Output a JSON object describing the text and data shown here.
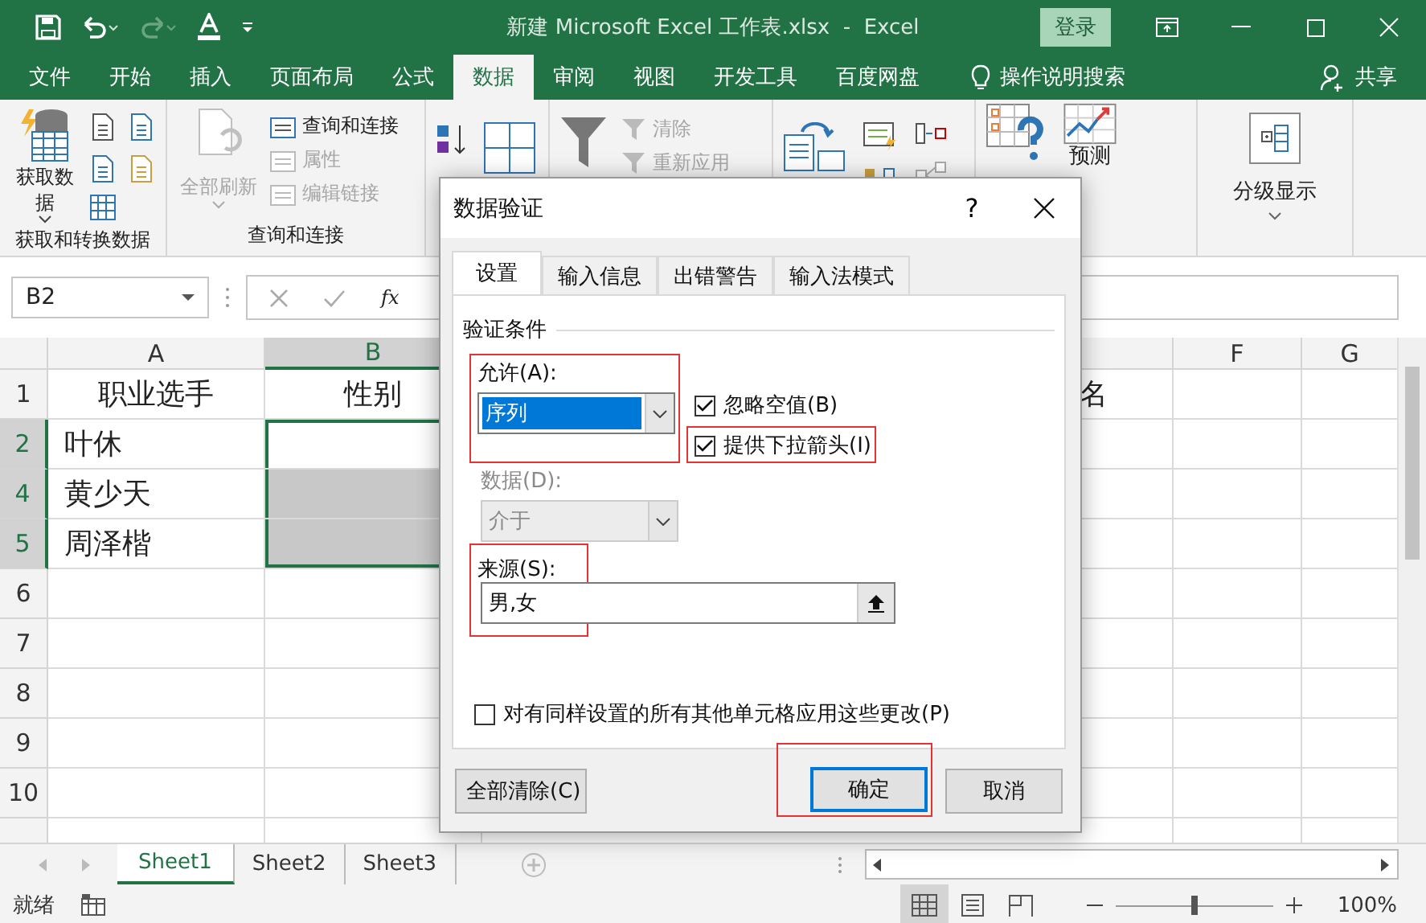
{
  "title_bar": {
    "title": "新建 Microsoft Excel 工作表.xlsx  -  Excel",
    "login": "登录"
  },
  "ribbon_tabs": [
    {
      "label": "文件",
      "selected": false
    },
    {
      "label": "开始",
      "selected": false
    },
    {
      "label": "插入",
      "selected": false
    },
    {
      "label": "页面布局",
      "selected": false
    },
    {
      "label": "公式",
      "selected": false
    },
    {
      "label": "数据",
      "selected": true
    },
    {
      "label": "审阅",
      "selected": false
    },
    {
      "label": "视图",
      "selected": false
    },
    {
      "label": "开发工具",
      "selected": false
    },
    {
      "label": "百度网盘",
      "selected": false
    }
  ],
  "tell_me": "操作说明搜索",
  "share": "共享",
  "ribbon": {
    "get_data": "获取数据",
    "group_labels": [
      "获取和转换数据",
      "查询和连接"
    ],
    "refresh_all": {
      "label": "全部刷新",
      "disabled": true
    },
    "query_commands": [
      {
        "label": "查询和连接",
        "disabled": false
      },
      {
        "label": "属性",
        "disabled": true
      },
      {
        "label": "编辑链接",
        "disabled": true
      }
    ],
    "filter_commands": [
      {
        "label": "清除",
        "disabled": true
      },
      {
        "label": "重新应用",
        "disabled": true
      }
    ],
    "forecast": "预测",
    "outline": "分级显示"
  },
  "formula_bar": {
    "name_box": "B2",
    "fx": "fx"
  },
  "columns": [
    {
      "label": "A",
      "selected": false
    },
    {
      "label": "B",
      "selected": true
    },
    {
      "label": "F",
      "selected": false
    },
    {
      "label": "G",
      "selected": false
    }
  ],
  "header_row": {
    "label": "1",
    "cells": [
      "职业选手",
      "性别",
      "名"
    ]
  },
  "rows": [
    {
      "label": "2",
      "name": "叶休",
      "selected": true,
      "active": true
    },
    {
      "label": "4",
      "name": "黄少天",
      "selected": true,
      "active": false
    },
    {
      "label": "5",
      "name": "周泽楷",
      "selected": true,
      "active": false
    },
    {
      "label": "6",
      "selected": false
    },
    {
      "label": "7",
      "selected": false
    },
    {
      "label": "8",
      "selected": false
    },
    {
      "label": "9",
      "selected": false
    },
    {
      "label": "10",
      "selected": false
    }
  ],
  "sheet_tabs": [
    {
      "label": "Sheet1",
      "selected": true
    },
    {
      "label": "Sheet2",
      "selected": false
    },
    {
      "label": "Sheet3",
      "selected": false
    }
  ],
  "status_bar": {
    "status": "就绪",
    "zoom": {
      "level": 0.5,
      "reading": "100%"
    }
  },
  "dialog": {
    "title": "数据验证",
    "help": "?",
    "tabs": [
      {
        "label": "设置",
        "selected": true
      },
      {
        "label": "输入信息",
        "selected": false
      },
      {
        "label": "出错警告",
        "selected": false
      },
      {
        "label": "输入法模式",
        "selected": false
      }
    ],
    "section": "验证条件",
    "allow": {
      "label": "允许(A):",
      "value": "序列",
      "highlighted": true
    },
    "ignore_blank": {
      "label": "忽略空值(B)",
      "checked": true,
      "highlighted": false
    },
    "dropdown": {
      "label": "提供下拉箭头(I)",
      "checked": true,
      "highlighted": true
    },
    "data": {
      "label": "数据(D):",
      "value": "介于",
      "disabled": true
    },
    "source": {
      "label": "来源(S):",
      "value": "男,女",
      "highlighted": true
    },
    "apply_all": {
      "label": "对有同样设置的所有其他单元格应用这些更改(P)",
      "checked": false
    },
    "buttons": [
      {
        "label": "全部清除(C)",
        "kind": "normal",
        "highlighted": false
      },
      {
        "label": "确定",
        "kind": "default",
        "highlighted": true
      },
      {
        "label": "取消",
        "kind": "normal",
        "highlighted": false
      }
    ]
  }
}
